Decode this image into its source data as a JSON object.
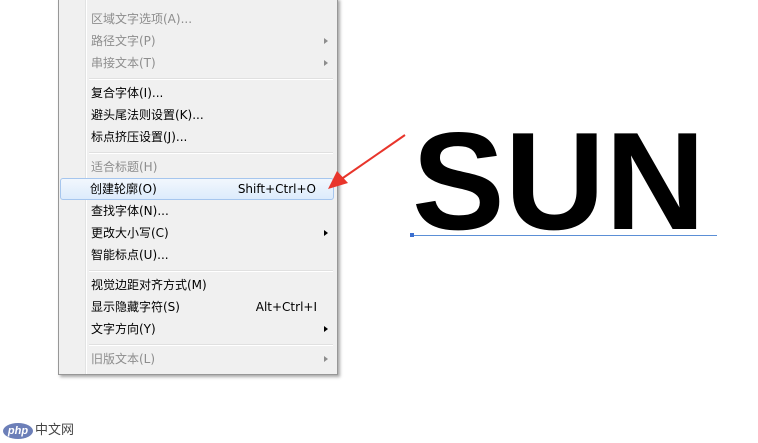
{
  "menu": {
    "items": [
      {
        "label": "区域文字选项(A)...",
        "shortcut": "",
        "disabled": true,
        "submenu": false
      },
      {
        "label": "路径文字(P)",
        "shortcut": "",
        "disabled": true,
        "submenu": true
      },
      {
        "label": "串接文本(T)",
        "shortcut": "",
        "disabled": true,
        "submenu": true
      },
      {
        "label": "复合字体(I)...",
        "shortcut": "",
        "disabled": false,
        "submenu": false
      },
      {
        "label": "避头尾法则设置(K)...",
        "shortcut": "",
        "disabled": false,
        "submenu": false
      },
      {
        "label": "标点挤压设置(J)...",
        "shortcut": "",
        "disabled": false,
        "submenu": false
      },
      {
        "label": "适合标题(H)",
        "shortcut": "",
        "disabled": true,
        "submenu": false
      },
      {
        "label": "创建轮廓(O)",
        "shortcut": "Shift+Ctrl+O",
        "disabled": false,
        "submenu": false,
        "highlighted": true
      },
      {
        "label": "查找字体(N)...",
        "shortcut": "",
        "disabled": false,
        "submenu": false
      },
      {
        "label": "更改大小写(C)",
        "shortcut": "",
        "disabled": false,
        "submenu": true
      },
      {
        "label": "智能标点(U)...",
        "shortcut": "",
        "disabled": false,
        "submenu": false
      },
      {
        "label": "视觉边距对齐方式(M)",
        "shortcut": "",
        "disabled": false,
        "submenu": false
      },
      {
        "label": "显示隐藏字符(S)",
        "shortcut": "Alt+Ctrl+I",
        "disabled": false,
        "submenu": false
      },
      {
        "label": "文字方向(Y)",
        "shortcut": "",
        "disabled": false,
        "submenu": true
      },
      {
        "label": "旧版文本(L)",
        "shortcut": "",
        "disabled": true,
        "submenu": true
      }
    ]
  },
  "canvas": {
    "text": "SUN",
    "arrow_color": "#e8352b",
    "baseline_color": "#5b8fd6"
  },
  "watermark": {
    "badge": "php",
    "text": "中文网"
  }
}
